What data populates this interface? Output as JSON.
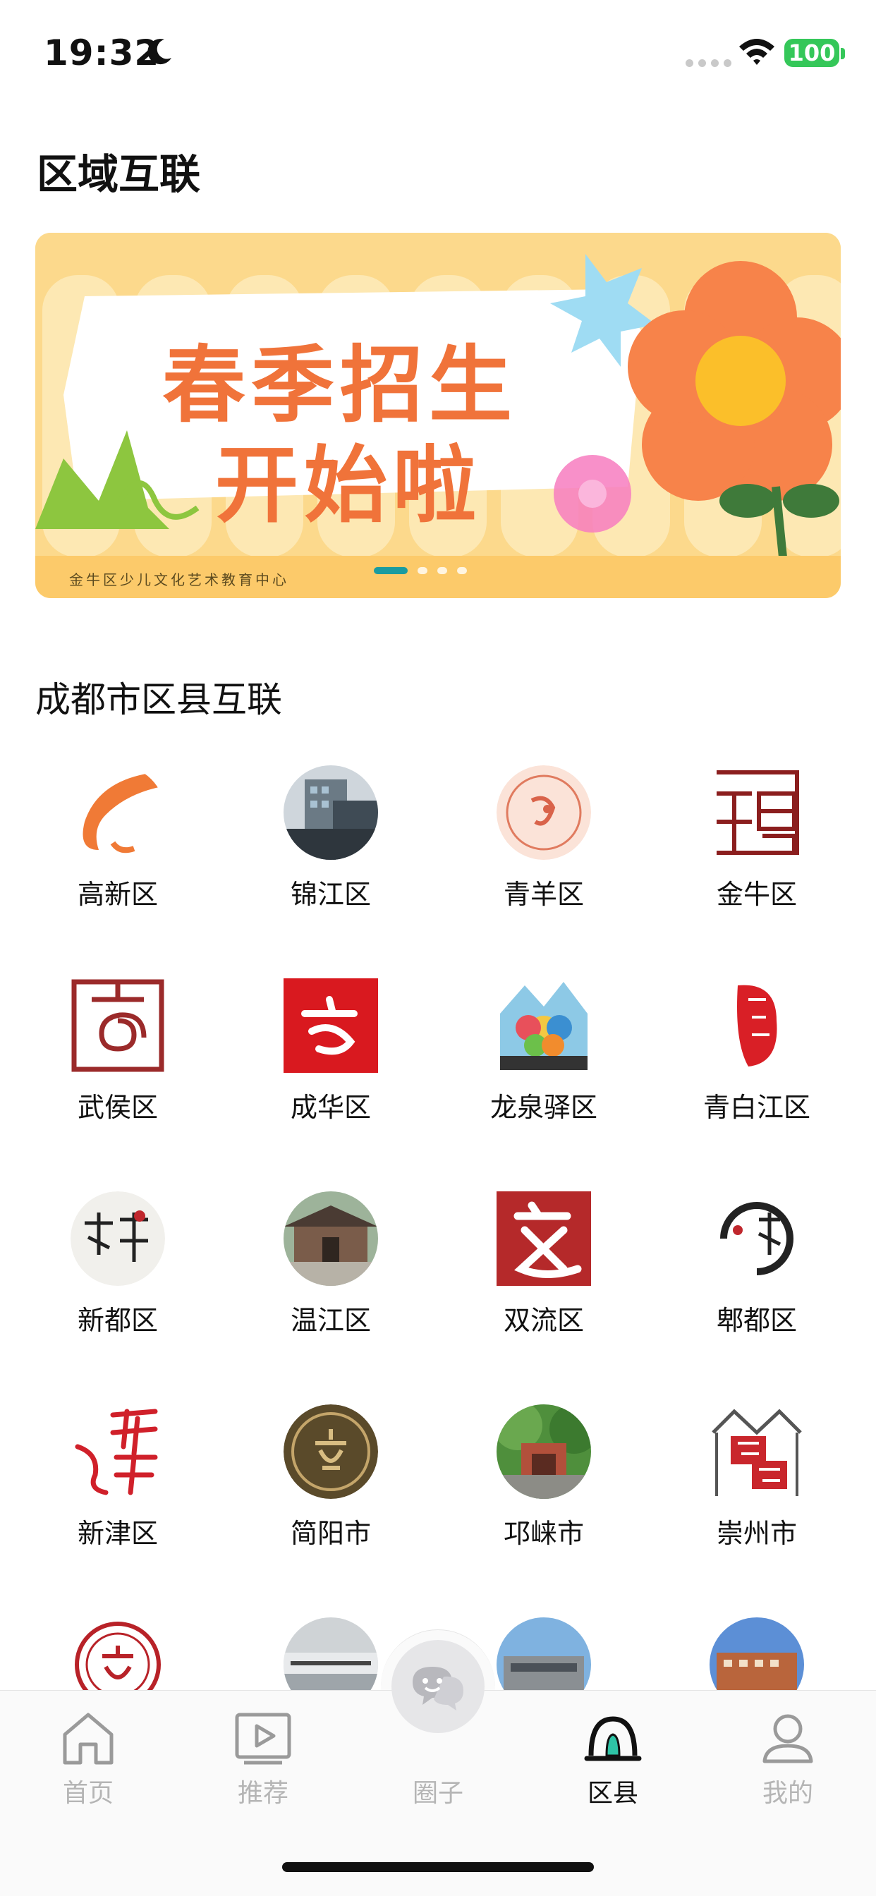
{
  "status": {
    "time": "19:32",
    "battery": "100"
  },
  "page": {
    "region_title": "区域互联",
    "district_title": "成都市区县互联"
  },
  "banner": {
    "line1": "春季招生",
    "line2": "开始啦",
    "footer": "金牛区少儿文化艺术教育中心",
    "slide_count": 4,
    "active_slide": 1
  },
  "districts": [
    {
      "name": "高新区",
      "icon": "swoosh-logo-icon"
    },
    {
      "name": "锦江区",
      "icon": "building-photo-icon"
    },
    {
      "name": "青羊区",
      "icon": "seal-logo-icon"
    },
    {
      "name": "金牛区",
      "icon": "calligraphy-logo-icon"
    },
    {
      "name": "武侯区",
      "icon": "spiral-logo-icon"
    },
    {
      "name": "成华区",
      "icon": "red-square-logo-icon"
    },
    {
      "name": "龙泉驿区",
      "icon": "flower-mountain-logo-icon"
    },
    {
      "name": "青白江区",
      "icon": "red-brush-logo-icon"
    },
    {
      "name": "新都区",
      "icon": "ink-calligraphy-icon"
    },
    {
      "name": "温江区",
      "icon": "temple-photo-icon"
    },
    {
      "name": "双流区",
      "icon": "wen-character-logo-icon"
    },
    {
      "name": "郫都区",
      "icon": "ink-circle-logo-icon"
    },
    {
      "name": "新津区",
      "icon": "red-calligraphy-icon"
    },
    {
      "name": "简阳市",
      "icon": "bronze-medal-icon"
    },
    {
      "name": "邛崃市",
      "icon": "forest-building-photo-icon"
    },
    {
      "name": "崇州市",
      "icon": "house-frame-logo-icon"
    },
    {
      "name": "",
      "icon": "red-ring-logo-icon"
    },
    {
      "name": "",
      "icon": "culture-center-photo-icon"
    },
    {
      "name": "",
      "icon": "modern-building-photo-icon"
    },
    {
      "name": "",
      "icon": "campus-photo-icon"
    }
  ],
  "tabs": [
    {
      "label": "首页",
      "icon": "home-icon"
    },
    {
      "label": "推荐",
      "icon": "play-icon"
    },
    {
      "label": "圈子",
      "icon": "chat-bubbles-icon"
    },
    {
      "label": "区县",
      "icon": "bell-dome-icon"
    },
    {
      "label": "我的",
      "icon": "profile-icon"
    }
  ],
  "colors": {
    "accent": "#f0733a",
    "banner_bg": "#fcd98c",
    "active_dot": "#1a9ba0",
    "inactive_tab": "#b5b5b5"
  }
}
